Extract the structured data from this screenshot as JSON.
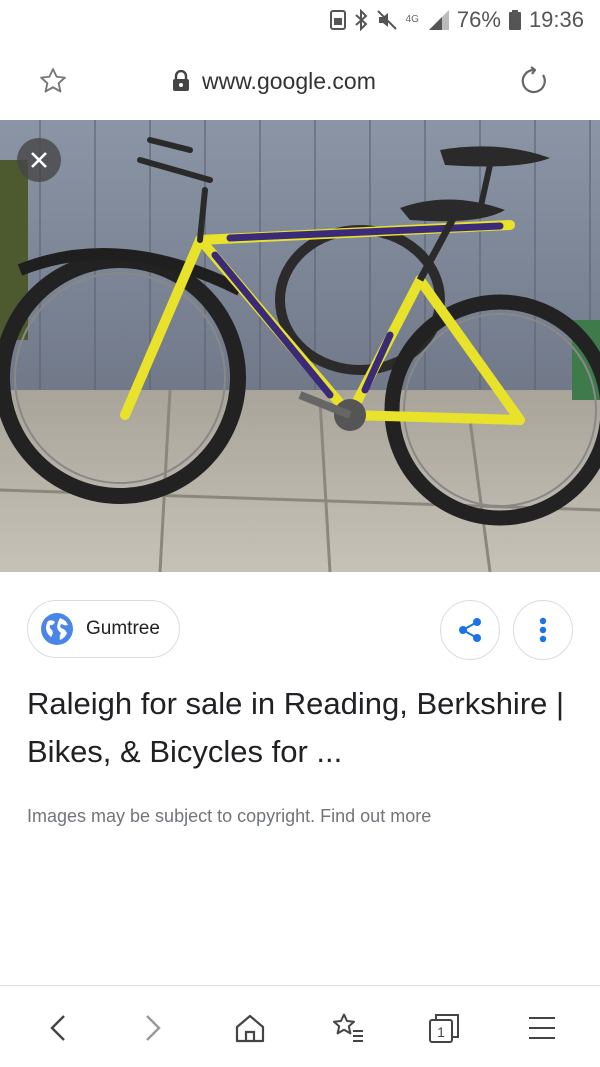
{
  "status_bar": {
    "network_label": "4G",
    "battery": "76%",
    "time": "19:36",
    "icons": [
      "sim-icon",
      "bluetooth-icon",
      "mute-icon",
      "signal-icon",
      "battery-icon"
    ]
  },
  "address_bar": {
    "url": "www.google.com",
    "icons": [
      "star-icon",
      "lock-icon",
      "reload-icon"
    ]
  },
  "image": {
    "alt": "yellow and purple mountain bike",
    "close_icon": "close-icon"
  },
  "source": {
    "name": "Gumtree",
    "icon": "globe-icon"
  },
  "actions": {
    "share_icon": "share-icon",
    "more_icon": "more-vert-icon"
  },
  "result": {
    "title": "Raleigh for sale in Reading, Berkshire | Bikes, & Bicycles for ..."
  },
  "copyright": {
    "text": "Images may be subject to copyright.",
    "link": "Find out more"
  },
  "bottom_nav": {
    "icons": [
      "back-icon",
      "forward-icon",
      "home-icon",
      "bookmarks-icon",
      "tabs-icon",
      "menu-icon"
    ],
    "tab_count": "1"
  },
  "colors": {
    "accent_blue": "#1a73e8",
    "bike_yellow": "#e8e22a",
    "bike_purple": "#3b2a7a",
    "wall_gray_blue": "#7f8899"
  }
}
